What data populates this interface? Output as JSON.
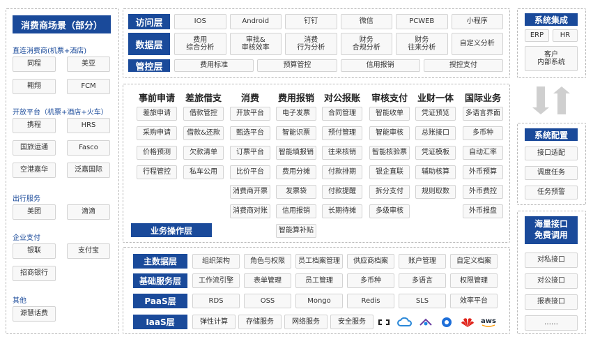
{
  "left": {
    "title": "消费商场景（部分）",
    "sections": [
      {
        "label": "直连消费商(机票+酒店)",
        "items": [
          "同程",
          "美亚",
          "翱翔",
          "FCM"
        ]
      },
      {
        "label": "开放平台（机票+酒店+火车）",
        "items": [
          "携程",
          "HRS",
          "国旅运通",
          "Fasco",
          "空港嘉华",
          "泛嘉国际"
        ]
      },
      {
        "label": "出行服务",
        "items": [
          "美团",
          "滴滴"
        ]
      },
      {
        "label": "企业支付",
        "items": [
          "银联",
          "支付宝",
          "招商银行"
        ]
      },
      {
        "label": "其他",
        "items": [
          "源慧话费"
        ]
      }
    ]
  },
  "top": {
    "rows": [
      {
        "label": "访问层",
        "items": [
          "IOS",
          "Android",
          "钉钉",
          "微信",
          "PCWEB",
          "小程序"
        ]
      },
      {
        "label": "数据层",
        "items": [
          "费用\n综合分析",
          "审批&\n审核效率",
          "消费\n行为分析",
          "财务\n合规分析",
          "财务\n往来分析",
          "自定义分析"
        ]
      },
      {
        "label": "管控层",
        "items": [
          "费用标准",
          "预算管控",
          "信用报销",
          "授控支付"
        ]
      }
    ]
  },
  "business": {
    "columns": [
      {
        "title": "事前申请",
        "items": [
          "差旅申请",
          "采购申请",
          "价格预测",
          "行程管控"
        ]
      },
      {
        "title": "差旅借支",
        "items": [
          "借款管控",
          "借款&还款",
          "欠款清单",
          "私车公用"
        ]
      },
      {
        "title": "消费",
        "items": [
          "开放平台",
          "甄选平台",
          "订票平台",
          "比价平台",
          "消费商开票",
          "消费商对账"
        ]
      },
      {
        "title": "费用报销",
        "items": [
          "电子发票",
          "智能识票",
          "智能填报销",
          "费用分摊",
          "发票袋",
          "信用报销",
          "智能算补贴"
        ]
      },
      {
        "title": "对公报账",
        "items": [
          "合同管理",
          "预付管理",
          "往来核销",
          "付款排期",
          "付款提醒",
          "长期待摊"
        ]
      },
      {
        "title": "审核支付",
        "items": [
          "智能收单",
          "智能审核",
          "智能核验票",
          "银企直联",
          "拆分支付",
          "多级审核"
        ]
      },
      {
        "title": "业财一体",
        "items": [
          "凭证预览",
          "总账接口",
          "凭证模板",
          "辅助核算",
          "规则取数"
        ]
      },
      {
        "title": "国际业务",
        "items": [
          "多语言界面",
          "多币种",
          "自动汇率",
          "外币预算",
          "外币费控",
          "外币报盘"
        ]
      }
    ],
    "label": "业务操作层"
  },
  "bottom": {
    "rows": [
      {
        "label": "主数据层",
        "items": [
          "组织架构",
          "角色与权限",
          "员工档案管理",
          "供应商档案",
          "账户管理",
          "自定义档案"
        ]
      },
      {
        "label": "基础服务层",
        "items": [
          "工作流引擎",
          "表单管理",
          "员工管理",
          "多币种",
          "多语言",
          "权限管理"
        ]
      },
      {
        "label": "PaaS层",
        "items": [
          "RDS",
          "OSS",
          "Mongo",
          "Redis",
          "SLS",
          "效率平台"
        ]
      },
      {
        "label": "IaaS层",
        "items": [
          "弹性计算",
          "存储服务",
          "网络服务",
          "安全服务"
        ]
      }
    ],
    "cloud_logos": [
      "aws"
    ]
  },
  "right": {
    "integration": {
      "title": "系统集成",
      "items": [
        "ERP",
        "HR",
        "客户\n内部系统"
      ]
    },
    "config": {
      "title": "系统配置",
      "items": [
        "接口适配",
        "调度任务",
        "任务预警"
      ]
    },
    "api": {
      "title": "海量接口\n免费调用",
      "items": [
        "对私接口",
        "对公接口",
        "报表接口",
        "……"
      ]
    }
  },
  "colors": {
    "brand": "#1a4a9a",
    "section_text": "#1a4a9a",
    "cell_bg": "#f8f8f8",
    "cell_border": "#d3d3d3"
  }
}
